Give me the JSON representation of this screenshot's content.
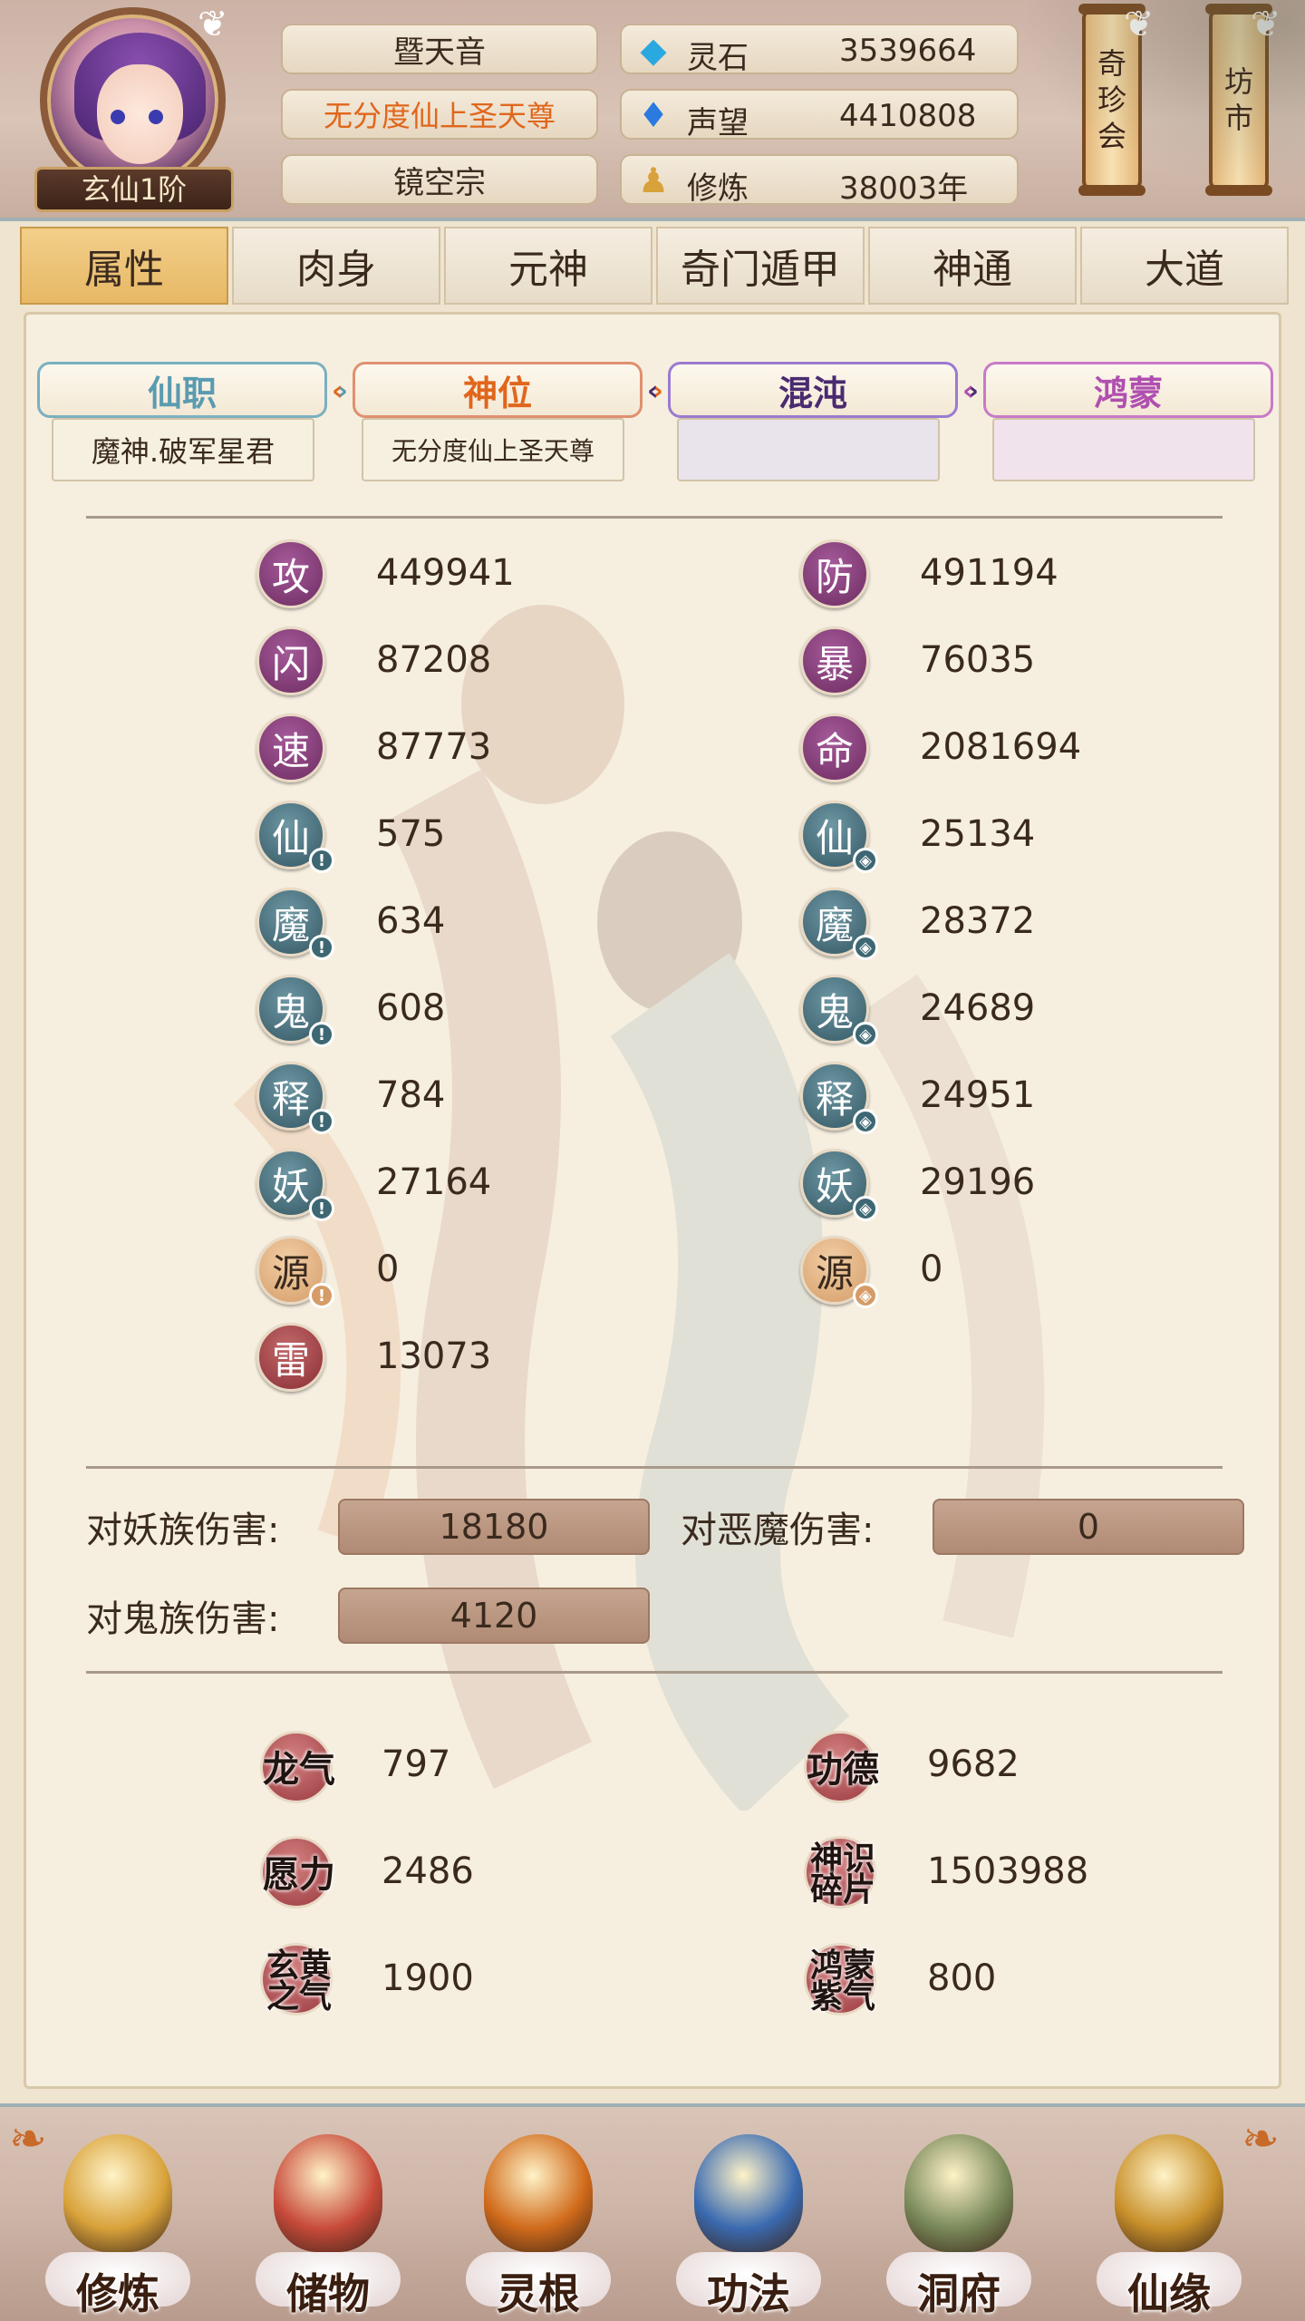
{
  "header": {
    "rank": "玄仙1阶",
    "name": "暨天音",
    "title": "无分度仙上圣天尊",
    "sect": "镜空宗",
    "resources": [
      {
        "icon": "spirit-stone-icon",
        "label": "灵石",
        "value": "3539664"
      },
      {
        "icon": "reputation-icon",
        "label": "声望",
        "value": "4410808"
      },
      {
        "icon": "cultivation-icon",
        "label": "修炼",
        "value": "38003年"
      }
    ],
    "right_buttons": [
      {
        "label": "奇珍会",
        "chars": [
          "奇",
          "珍",
          "会"
        ]
      },
      {
        "label": "坊市",
        "chars": [
          "坊",
          "市"
        ]
      }
    ]
  },
  "tabs": [
    "属性",
    "肉身",
    "元神",
    "奇门遁甲",
    "神通",
    "大道"
  ],
  "active_tab": "属性",
  "titles": [
    {
      "tag": "仙职",
      "value": "魔神.破军星君",
      "color": "#5a9bb0"
    },
    {
      "tag": "神位",
      "value": "无分度仙上圣天尊",
      "color": "#e0661c"
    },
    {
      "tag": "混沌",
      "value": "",
      "color": "#6a4fb0"
    },
    {
      "tag": "鸿蒙",
      "value": "",
      "color": "#b04fb0"
    }
  ],
  "stats_left": [
    {
      "char": "攻",
      "value": "449941",
      "style": "purple",
      "sub": ""
    },
    {
      "char": "闪",
      "value": "87208",
      "style": "purple",
      "sub": ""
    },
    {
      "char": "速",
      "value": "87773",
      "style": "purple",
      "sub": ""
    },
    {
      "char": "仙",
      "value": "575",
      "style": "teal",
      "sub": "!"
    },
    {
      "char": "魔",
      "value": "634",
      "style": "teal",
      "sub": "!"
    },
    {
      "char": "鬼",
      "value": "608",
      "style": "teal",
      "sub": "!"
    },
    {
      "char": "释",
      "value": "784",
      "style": "teal",
      "sub": "!"
    },
    {
      "char": "妖",
      "value": "27164",
      "style": "teal",
      "sub": "!"
    },
    {
      "char": "源",
      "value": "0",
      "style": "tan",
      "sub": "!"
    },
    {
      "char": "雷",
      "value": "13073",
      "style": "red",
      "sub": ""
    }
  ],
  "stats_right": [
    {
      "char": "防",
      "value": "491194",
      "style": "purple",
      "sub": ""
    },
    {
      "char": "暴",
      "value": "76035",
      "style": "purple",
      "sub": ""
    },
    {
      "char": "命",
      "value": "2081694",
      "style": "purple",
      "sub": ""
    },
    {
      "char": "仙",
      "value": "25134",
      "style": "teal",
      "sub": "◘"
    },
    {
      "char": "魔",
      "value": "28372",
      "style": "teal",
      "sub": "◘"
    },
    {
      "char": "鬼",
      "value": "24689",
      "style": "teal",
      "sub": "◘"
    },
    {
      "char": "释",
      "value": "24951",
      "style": "teal",
      "sub": "◘"
    },
    {
      "char": "妖",
      "value": "29196",
      "style": "teal",
      "sub": "◘"
    },
    {
      "char": "源",
      "value": "0",
      "style": "tan",
      "sub": "◘"
    }
  ],
  "damage": [
    {
      "label": "对妖族伤害:",
      "value": "18180"
    },
    {
      "label": "对恶魔伤害:",
      "value": "0"
    },
    {
      "label": "对鬼族伤害:",
      "value": "4120"
    }
  ],
  "special": [
    {
      "label": "龙气",
      "value": "797"
    },
    {
      "label": "功德",
      "value": "9682"
    },
    {
      "label": "愿力",
      "value": "2486"
    },
    {
      "label": "神识碎片",
      "value": "1503988"
    },
    {
      "label": "玄黄之气",
      "value": "1900"
    },
    {
      "label": "鸿蒙紫气",
      "value": "800"
    }
  ],
  "bottom_nav": [
    {
      "label": "修炼",
      "icon": "cultivation-monk-icon",
      "color": "#d8a23a"
    },
    {
      "label": "储物",
      "icon": "storage-bag-icon",
      "color": "#c84a3a"
    },
    {
      "label": "灵根",
      "icon": "spirit-root-icon",
      "color": "#d06a1a"
    },
    {
      "label": "功法",
      "icon": "technique-book-icon",
      "color": "#3a6ab0"
    },
    {
      "label": "洞府",
      "icon": "cave-mansion-icon",
      "color": "#7a8a5a"
    },
    {
      "label": "仙缘",
      "icon": "immortal-fate-icon",
      "color": "#c8902a"
    }
  ]
}
